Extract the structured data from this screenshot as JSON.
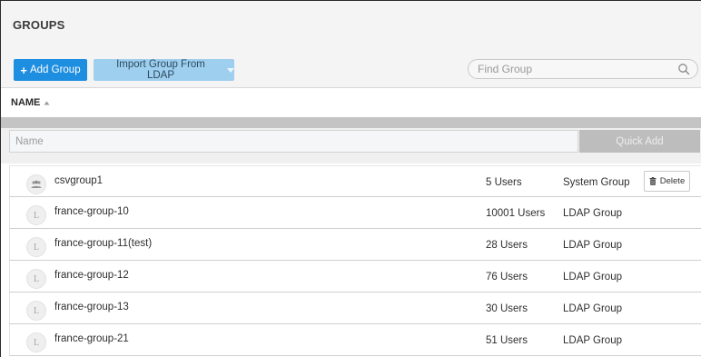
{
  "header": {
    "title": "GROUPS",
    "add_group_label": "Add Group",
    "add_group_icon": "plus-icon",
    "import_label": "Import Group From LDAP",
    "import_icon": "caret-down-icon",
    "search_placeholder": "Find Group",
    "search_icon": "search-icon"
  },
  "table": {
    "column_header": "NAME",
    "sort_direction": "ascending",
    "quick_add": {
      "name_placeholder": "Name",
      "button_label": "Quick Add"
    },
    "rows": [
      {
        "avatar": "users-icon",
        "name": "csvgroup1",
        "users": "5 Users",
        "type": "System Group",
        "action": "Delete"
      },
      {
        "avatar": "L",
        "name": "france-group-10",
        "users": "10001 Users",
        "type": "LDAP Group"
      },
      {
        "avatar": "L",
        "name": "france-group-11(test)",
        "users": "28 Users",
        "type": "LDAP Group"
      },
      {
        "avatar": "L",
        "name": "france-group-12",
        "users": "76 Users",
        "type": "LDAP Group"
      },
      {
        "avatar": "L",
        "name": "france-group-13",
        "users": "30 Users",
        "type": "LDAP Group"
      },
      {
        "avatar": "L",
        "name": "france-group-21",
        "users": "51 Users",
        "type": "LDAP Group"
      }
    ]
  },
  "colors": {
    "primary": "#1e8ee0",
    "secondary": "#9ecfef",
    "disabled": "#bdbdbd"
  }
}
